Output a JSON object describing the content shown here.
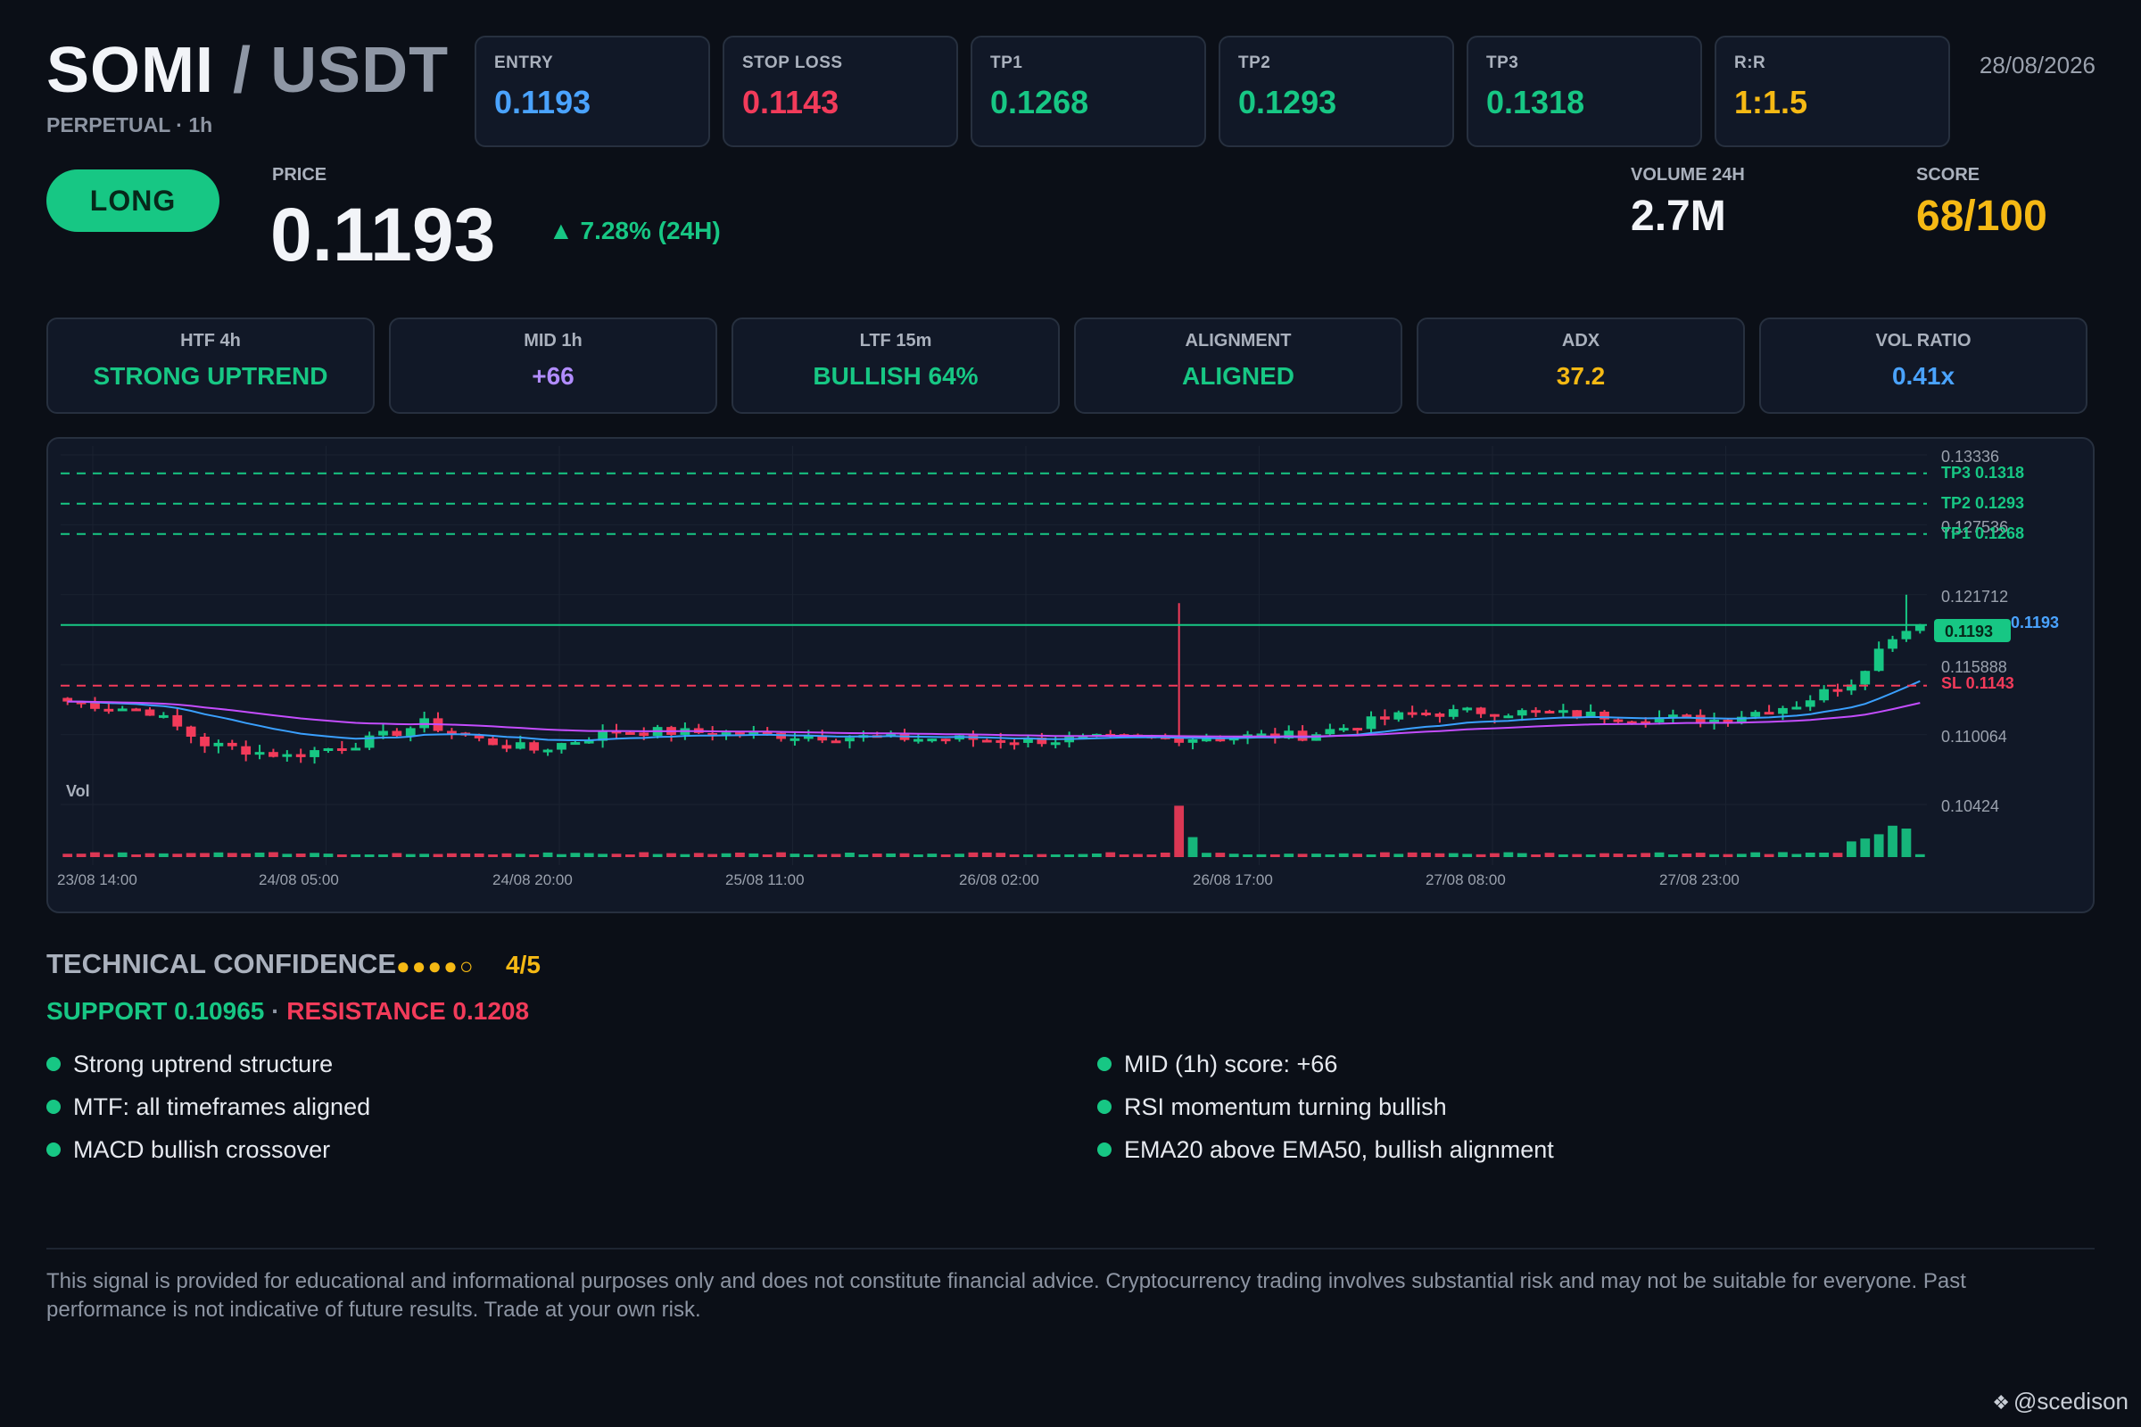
{
  "header": {
    "base": "SOMI",
    "separator": "/",
    "quote": "USDT",
    "subtitle": "PERPETUAL · 1h",
    "date": "28/08/2026"
  },
  "levels": [
    {
      "label": "ENTRY",
      "value": "0.1193",
      "color": "#4aa3ff"
    },
    {
      "label": "STOP LOSS",
      "value": "0.1143",
      "color": "#f23b5a"
    },
    {
      "label": "TP1",
      "value": "0.1268",
      "color": "#17c784"
    },
    {
      "label": "TP2",
      "value": "0.1293",
      "color": "#17c784"
    },
    {
      "label": "TP3",
      "value": "0.1318",
      "color": "#17c784"
    },
    {
      "label": "R:R",
      "value": "1:1.5",
      "color": "#f5b914"
    }
  ],
  "direction": "LONG",
  "price": {
    "label": "PRICE",
    "value": "0.1193",
    "change": "▲ 7.28% (24H)"
  },
  "volume": {
    "label": "VOLUME 24H",
    "value": "2.7M"
  },
  "score": {
    "label": "SCORE",
    "value": "68/100"
  },
  "metrics": [
    {
      "label": "HTF 4h",
      "value": "STRONG UPTREND",
      "color": "#17c784"
    },
    {
      "label": "MID 1h",
      "value": "+66",
      "color": "#b18cff"
    },
    {
      "label": "LTF 15m",
      "value": "BULLISH 64%",
      "color": "#17c784"
    },
    {
      "label": "ALIGNMENT",
      "value": "ALIGNED",
      "color": "#17c784"
    },
    {
      "label": "ADX",
      "value": "37.2",
      "color": "#f5b914"
    },
    {
      "label": "VOL RATIO",
      "value": "0.41x",
      "color": "#4aa3ff"
    }
  ],
  "chart": {
    "price_axis": [
      "0.13336",
      "0.127536",
      "0.121712",
      "0.115888",
      "0.110064",
      "0.10424"
    ],
    "time_axis": [
      "23/08 14:00",
      "24/08 05:00",
      "24/08 20:00",
      "25/08 11:00",
      "26/08 02:00",
      "26/08 17:00",
      "27/08 08:00",
      "27/08 23:00"
    ],
    "tp3_label": "TP3 0.1318",
    "tp2_label": "TP2 0.1293",
    "tp1_label": "TP1 0.1268",
    "sl_label": "SL 0.1143",
    "entry_label": "0.1193",
    "price_tag": "0.1193",
    "vol_label": "Vol"
  },
  "chart_data": {
    "type": "candlestick",
    "y_range": [
      0.1012,
      0.1345
    ],
    "levels": {
      "tp3": 0.1318,
      "tp2": 0.1293,
      "tp1": 0.1268,
      "entry": 0.1193,
      "sl": 0.1143
    },
    "last_price": 0.1193,
    "colors": {
      "up": "#17c784",
      "down": "#f23b5a",
      "ema20": "#3aa0ff",
      "ema50": "#c44dff"
    },
    "candle_count": 136,
    "keypoints": [
      [
        0,
        0.113
      ],
      [
        6,
        0.1122
      ],
      [
        10,
        0.1095
      ],
      [
        16,
        0.1085
      ],
      [
        22,
        0.1098
      ],
      [
        26,
        0.1112
      ],
      [
        30,
        0.1098
      ],
      [
        34,
        0.109
      ],
      [
        40,
        0.1106
      ],
      [
        50,
        0.1103
      ],
      [
        60,
        0.11
      ],
      [
        70,
        0.1098
      ],
      [
        80,
        0.11
      ],
      [
        90,
        0.1102
      ],
      [
        98,
        0.112
      ],
      [
        104,
        0.1122
      ],
      [
        110,
        0.1119
      ],
      [
        120,
        0.1115
      ],
      [
        126,
        0.1128
      ],
      [
        130,
        0.1147
      ],
      [
        133,
        0.1185
      ],
      [
        135,
        0.1193
      ]
    ],
    "spikes": [
      {
        "i": 81,
        "high": 0.1211
      },
      {
        "i": 134,
        "high": 0.1218
      }
    ],
    "volume_profile": {
      "base": 0.25,
      "spikes": [
        [
          81,
          3.6
        ],
        [
          82,
          1.4
        ],
        [
          130,
          1.1
        ],
        [
          131,
          1.3
        ],
        [
          132,
          1.6
        ],
        [
          133,
          2.2
        ],
        [
          134,
          2.0
        ]
      ]
    }
  },
  "confidence": {
    "title": "TECHNICAL CONFIDENCE",
    "dots": "●●●●○",
    "score": "4/5",
    "support": "SUPPORT 0.10965",
    "sep": " · ",
    "resistance": "RESISTANCE 0.1208",
    "reasons_left": [
      "Strong uptrend structure",
      "MTF: all timeframes aligned",
      "MACD bullish crossover"
    ],
    "reasons_right": [
      "MID (1h) score: +66",
      "RSI momentum turning bullish",
      "EMA20 above EMA50, bullish alignment"
    ]
  },
  "disclaimer": "This signal is provided for educational and informational purposes only and does not constitute financial advice. Cryptocurrency trading involves substantial risk and may not be suitable for everyone. Past performance is not indicative of future results. Trade at your own risk.",
  "watermark": {
    "icon": "binance-logo-icon",
    "text": "@scedison"
  }
}
